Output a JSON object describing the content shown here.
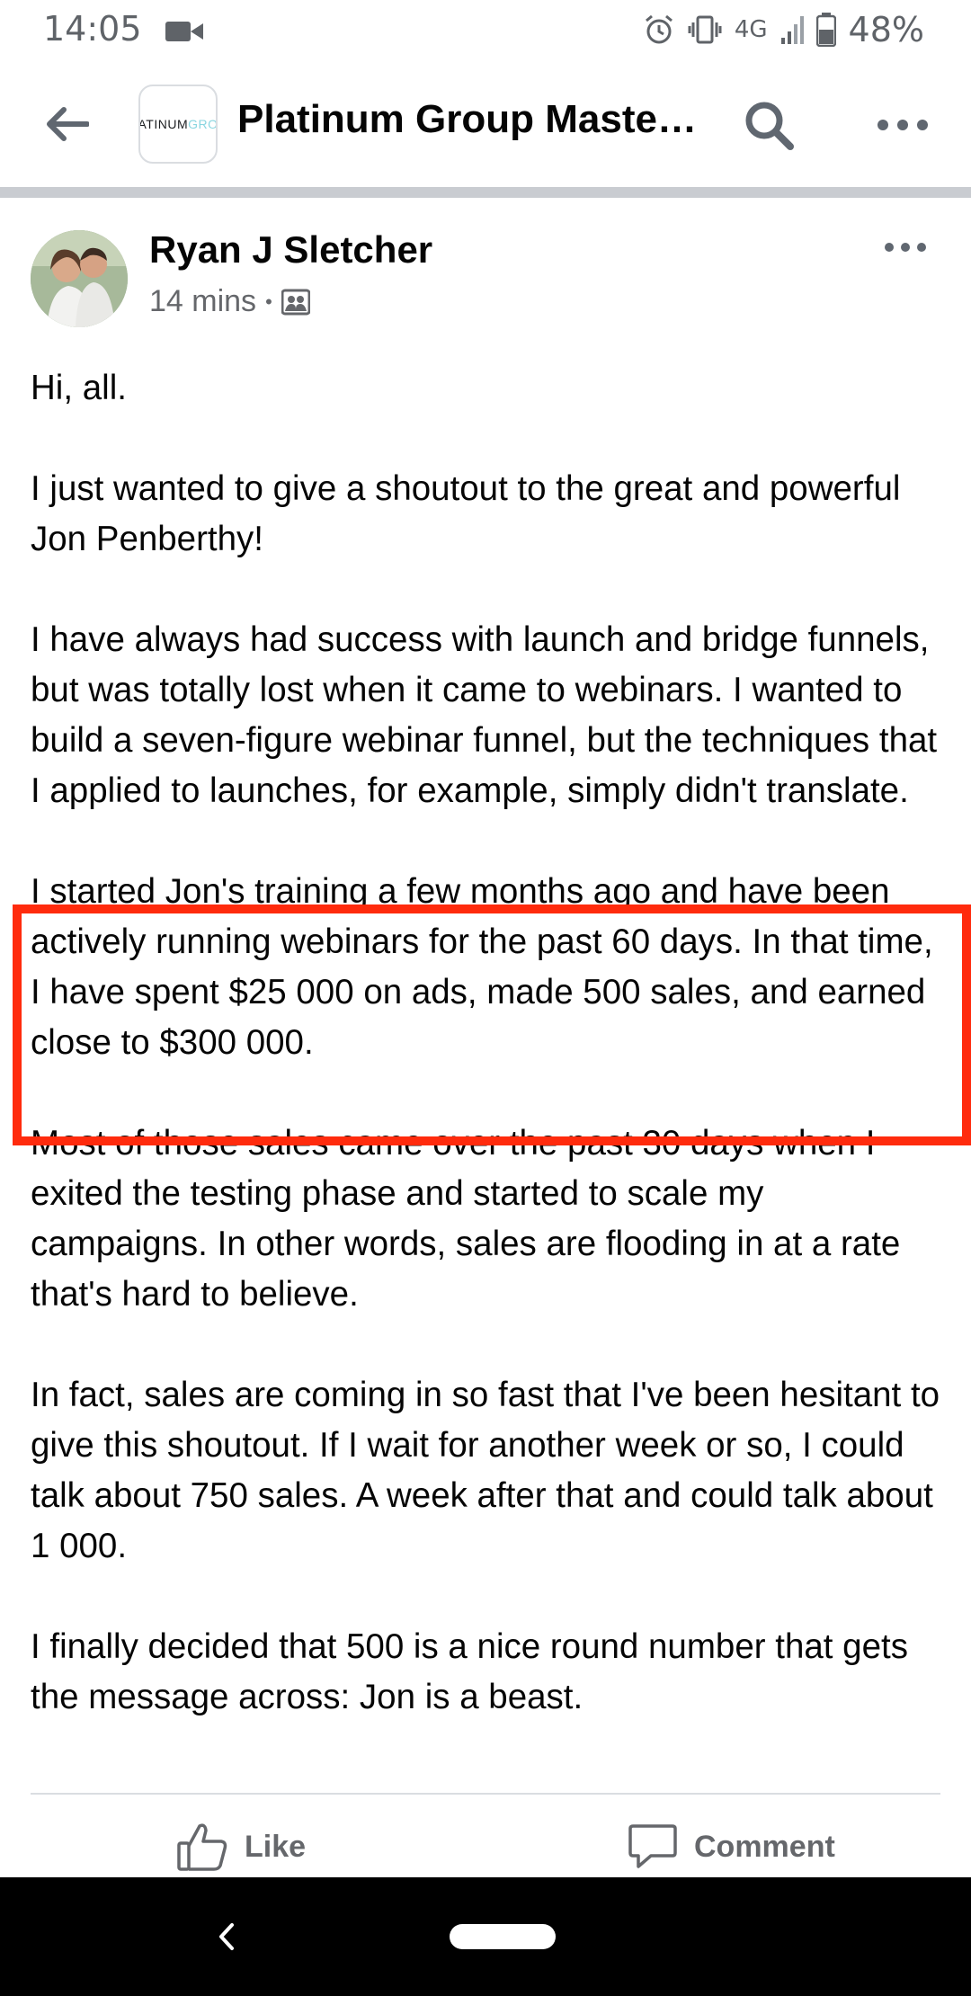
{
  "status_bar": {
    "time": "14:05",
    "network": "4G",
    "battery": "48%",
    "icons": [
      "video-camera-icon",
      "alarm-icon",
      "vibrate-icon",
      "signal-icon",
      "battery-icon"
    ]
  },
  "header": {
    "logo_text_dark": "ATINUM",
    "logo_text_light": "GRO",
    "title": "Platinum Group Maste…",
    "icons": [
      "back-arrow-icon",
      "search-icon",
      "more-icon"
    ]
  },
  "post": {
    "author": "Ryan J Sletcher",
    "time": "14 mins",
    "meta_separator": "•",
    "audience_icon": "group-audience-icon",
    "paragraphs": [
      "Hi, all.",
      "I just wanted to give a shoutout to the great and powerful Jon Penberthy!",
      "I have always had success with launch and bridge funnels, but was totally lost when it came to webinars. I wanted to build a seven-figure webinar funnel, but the techniques that I applied to launches, for example, simply didn't translate.",
      "I started Jon's training a few months ago and have been actively running webinars for the past 60 days. In that time, I have spent $25 000 on ads, made 500 sales, and earned close to $300 000.",
      "Most of those sales came over the past 30 days when I exited the testing phase and started to scale my campaigns. In other words, sales are flooding in at a rate that's hard to believe.",
      "In fact, sales are coming in so fast that I've been hesitant to give this shoutout. If I wait for another week or so, I could talk about 750 sales. A week after that and could talk about 1 000.",
      "I finally decided that 500 is a nice round number that gets the message across: Jon is a beast."
    ]
  },
  "actions": {
    "like_label": "Like",
    "comment_label": "Comment"
  },
  "colors": {
    "highlight": "#ff2b0d",
    "text_primary": "#050505",
    "text_secondary": "#65676b",
    "divider": "#c9ccd1"
  }
}
